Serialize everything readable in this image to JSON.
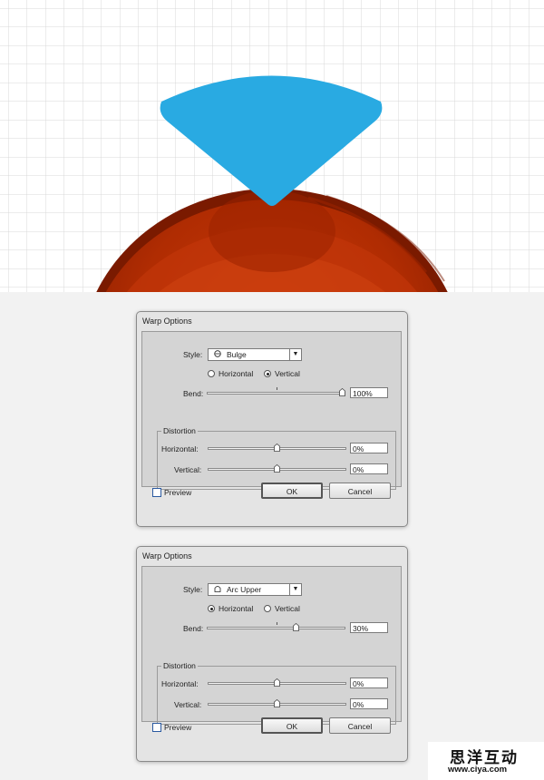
{
  "canvas": {
    "grid_color": "#d9d9d9",
    "shape_blue": "#29aae2",
    "sphere_colors": [
      "#8a1e00",
      "#b02a00",
      "#cc3a08"
    ]
  },
  "dialogs": [
    {
      "title": "Warp Options",
      "style_label": "Style:",
      "style_value": "Bulge",
      "style_icon": "bulge-icon",
      "horizontal_label": "Horizontal",
      "vertical_label": "Vertical",
      "orientation": "vertical",
      "bend_label": "Bend:",
      "bend_value": "100%",
      "bend_fraction": 1.0,
      "distortion_label": "Distortion",
      "dist_horizontal_label": "Horizontal:",
      "dist_horizontal_value": "0%",
      "dist_horizontal_fraction": 0.5,
      "dist_vertical_label": "Vertical:",
      "dist_vertical_value": "0%",
      "dist_vertical_fraction": 0.5,
      "preview_label": "Preview",
      "preview_checked": false,
      "ok_label": "OK",
      "cancel_label": "Cancel"
    },
    {
      "title": "Warp Options",
      "style_label": "Style:",
      "style_value": "Arc Upper",
      "style_icon": "arc-upper-icon",
      "horizontal_label": "Horizontal",
      "vertical_label": "Vertical",
      "orientation": "horizontal",
      "bend_label": "Bend:",
      "bend_value": "30%",
      "bend_fraction": 0.65,
      "distortion_label": "Distortion",
      "dist_horizontal_label": "Horizontal:",
      "dist_horizontal_value": "0%",
      "dist_horizontal_fraction": 0.5,
      "dist_vertical_label": "Vertical:",
      "dist_vertical_value": "0%",
      "dist_vertical_fraction": 0.5,
      "preview_label": "Preview",
      "preview_checked": false,
      "ok_label": "OK",
      "cancel_label": "Cancel"
    }
  ],
  "watermark": {
    "chinese": "思洋互动",
    "url": "www.ciya.com"
  }
}
